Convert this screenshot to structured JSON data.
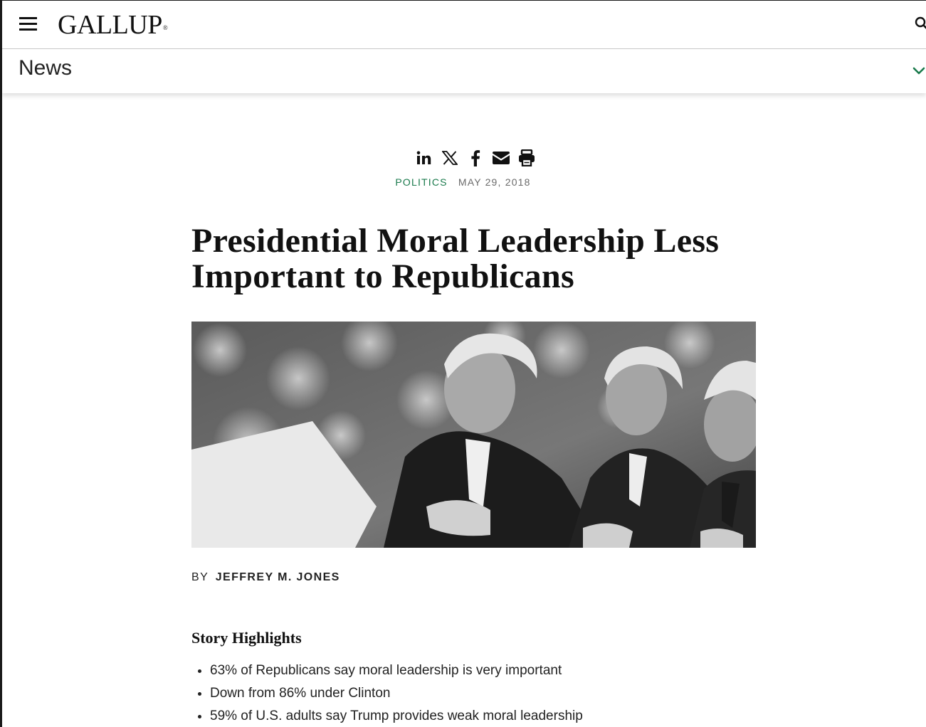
{
  "header": {
    "logo_text": "GALLUP",
    "logo_mark": "®",
    "menu_icon": "hamburger-menu-icon",
    "search_icon": "search-icon"
  },
  "subnav": {
    "title": "News",
    "chevron_icon": "chevron-down-icon",
    "accent_color": "#1a7a4c"
  },
  "share": {
    "icons": [
      "linkedin-icon",
      "x-icon",
      "facebook-icon",
      "email-icon",
      "print-icon"
    ]
  },
  "article": {
    "topic": "POLITICS",
    "date": "MAY 29, 2018",
    "title": "Presidential Moral Leadership Less Important to Republicans",
    "image_alt": "Black-and-white photo of three men in suits with hands over hearts",
    "byline_prefix": "BY",
    "author": "JEFFREY M. JONES",
    "highlights_heading": "Story Highlights",
    "highlights": [
      "63% of Republicans say moral leadership is very important",
      "Down from 86% under Clinton",
      "59% of U.S. adults say Trump provides weak moral leadership"
    ]
  },
  "colors": {
    "topic_green": "#1a7a4c",
    "text_dark": "#111111",
    "date_gray": "#6a6a6a"
  }
}
